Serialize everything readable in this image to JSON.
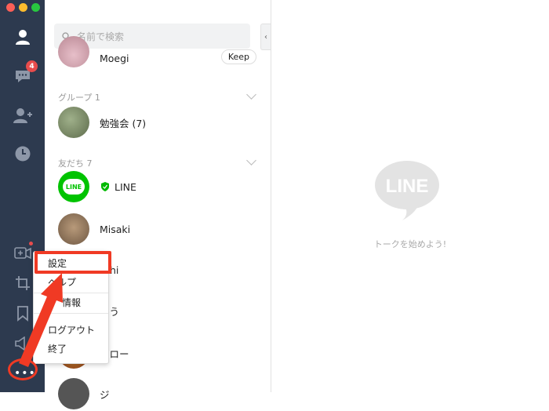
{
  "sidebar": {
    "chat_badge": "4",
    "items": [
      {
        "icon": "person-icon"
      },
      {
        "icon": "chat-bubble-icon"
      },
      {
        "icon": "add-friend-icon"
      },
      {
        "icon": "clock-icon"
      },
      {
        "icon": "video-add-icon"
      },
      {
        "icon": "crop-icon"
      },
      {
        "icon": "bookmark-icon"
      },
      {
        "icon": "speaker-icon"
      },
      {
        "icon": "more-icon"
      }
    ]
  },
  "search": {
    "placeholder": "名前で検索"
  },
  "list": {
    "top_contact": {
      "name": "Moegi",
      "keep_label": "Keep"
    },
    "group_section": "グループ 1",
    "groups": [
      {
        "name": "勉強会 (7)"
      }
    ],
    "friends_section": "友だち 7",
    "friends": [
      {
        "name": "LINE",
        "verified": true
      },
      {
        "name": "Misaki"
      },
      {
        "name": "hi"
      },
      {
        "name": "とう"
      },
      {
        "name": "ブロー"
      },
      {
        "name": "ジ"
      }
    ]
  },
  "chat": {
    "logo_text": "LINE",
    "hint": "トークを始めよう!"
  },
  "menu": {
    "items": [
      "設定",
      "ヘルプ",
      "情報",
      "ログアウト",
      "終了"
    ]
  },
  "colors": {
    "sidebar": "#2d3a4f",
    "line_green": "#00c300",
    "annotation_red": "#f03a24",
    "badge_red": "#e84c4c"
  }
}
